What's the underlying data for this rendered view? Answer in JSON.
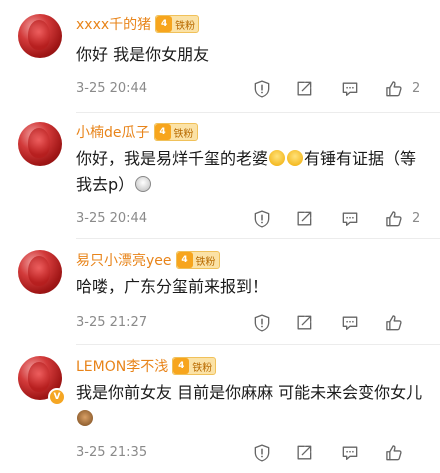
{
  "comments": [
    {
      "username": "xxxx千的猪",
      "badge_level": "4",
      "badge_label": "铁粉",
      "text": "你好 我是你女朋友",
      "time": "3-25 20:44",
      "likes": "2"
    },
    {
      "username": "小楠de瓜子",
      "badge_level": "4",
      "badge_label": "铁粉",
      "text_part1": "你好，我是易烊千玺的老婆",
      "text_part2": "有锤有证据（等我去p）",
      "time": "3-25 20:44",
      "likes": "2"
    },
    {
      "username": "易只小漂亮yee",
      "badge_level": "4",
      "badge_label": "铁粉",
      "text": "哈喽，广东分玺前来报到！",
      "time": "3-25 21:27",
      "likes": ""
    },
    {
      "username": "LEMON李不浅",
      "badge_level": "4",
      "badge_label": "铁粉",
      "text": "我是你前女友 目前是你麻麻  可能未来会变你女儿",
      "time": "3-25 21:35",
      "likes": ""
    }
  ],
  "icons": {
    "report": "report-icon",
    "share": "share-icon",
    "comment": "comment-icon",
    "like": "like-icon"
  },
  "colors": {
    "username": "#e8841a",
    "meta": "#8a8a8a",
    "badge": "#f7a51d"
  }
}
